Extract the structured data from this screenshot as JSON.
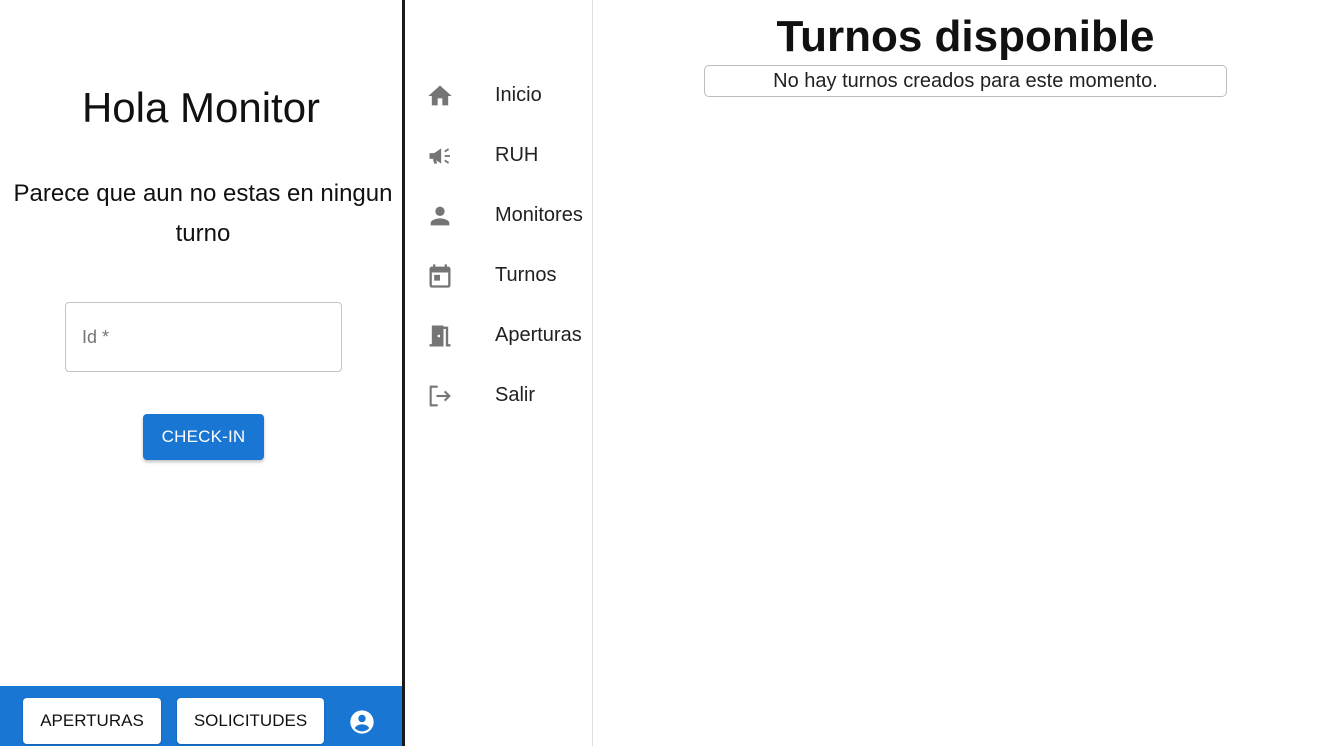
{
  "left_panel": {
    "greeting": "Hola Monitor",
    "status_message": "Parece que aun no estas en ningun turno",
    "id_field": {
      "label": "Id *",
      "value": ""
    },
    "checkin_label": "CHECK-IN",
    "bottom_bar": {
      "aperturas_label": "APERTURAS",
      "solicitudes_label": "SOLICITUDES",
      "account_icon": "account-circle-icon",
      "color": "#1976d2"
    }
  },
  "nav": {
    "items": [
      {
        "label": "Inicio",
        "icon": "home-icon"
      },
      {
        "label": "RUH",
        "icon": "campaign-icon"
      },
      {
        "label": "Monitores",
        "icon": "person-icon"
      },
      {
        "label": "Turnos",
        "icon": "calendar-icon"
      },
      {
        "label": "Aperturas",
        "icon": "door-icon"
      },
      {
        "label": "Salir",
        "icon": "logout-icon"
      }
    ]
  },
  "main": {
    "title": "Turnos disponible",
    "notice": "No hay turnos creados para este momento."
  },
  "colors": {
    "accent": "#1976d2",
    "icon": "#757575"
  }
}
